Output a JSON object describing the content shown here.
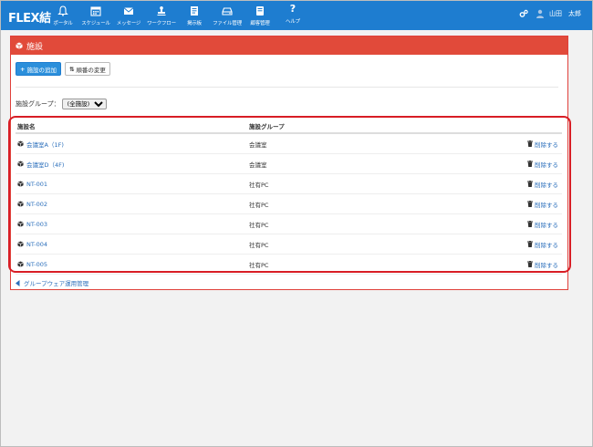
{
  "header": {
    "logo": "FLEX結",
    "nav": [
      {
        "label": "ポータル",
        "icon": "bell-icon"
      },
      {
        "label": "スケジュール",
        "icon": "calendar-icon"
      },
      {
        "label": "メッセージ",
        "icon": "envelope-icon"
      },
      {
        "label": "ワークフロー",
        "icon": "stamp-icon"
      },
      {
        "label": "掲示板",
        "icon": "board-icon"
      },
      {
        "label": "ファイル管理",
        "icon": "drive-icon"
      },
      {
        "label": "顧客管理",
        "icon": "customer-icon"
      },
      {
        "label": "ヘルプ",
        "icon": "question-icon"
      }
    ],
    "user_name": "山田　太郎"
  },
  "panel": {
    "title": "施設",
    "add_button": "施設の追加",
    "order_button": "順番の変更",
    "filter_label": "施設グループ：",
    "filter_value": "(全施設)"
  },
  "table": {
    "headers": [
      "施設名",
      "施設グループ"
    ],
    "delete_label": "削除する",
    "rows": [
      {
        "name": "会議室A（1F)",
        "group": "会議室"
      },
      {
        "name": "会議室D（4F)",
        "group": "会議室"
      },
      {
        "name": "NT-001",
        "group": "社有PC"
      },
      {
        "name": "NT-002",
        "group": "社有PC"
      },
      {
        "name": "NT-003",
        "group": "社有PC"
      },
      {
        "name": "NT-004",
        "group": "社有PC"
      },
      {
        "name": "NT-005",
        "group": "社有PC"
      }
    ]
  },
  "footer_link": "グループウェア運用管理",
  "colors": {
    "topbar": "#1e7dd0",
    "panel_header": "#e14a3a",
    "highlight": "#d81d25",
    "link": "#2a6ebb"
  }
}
